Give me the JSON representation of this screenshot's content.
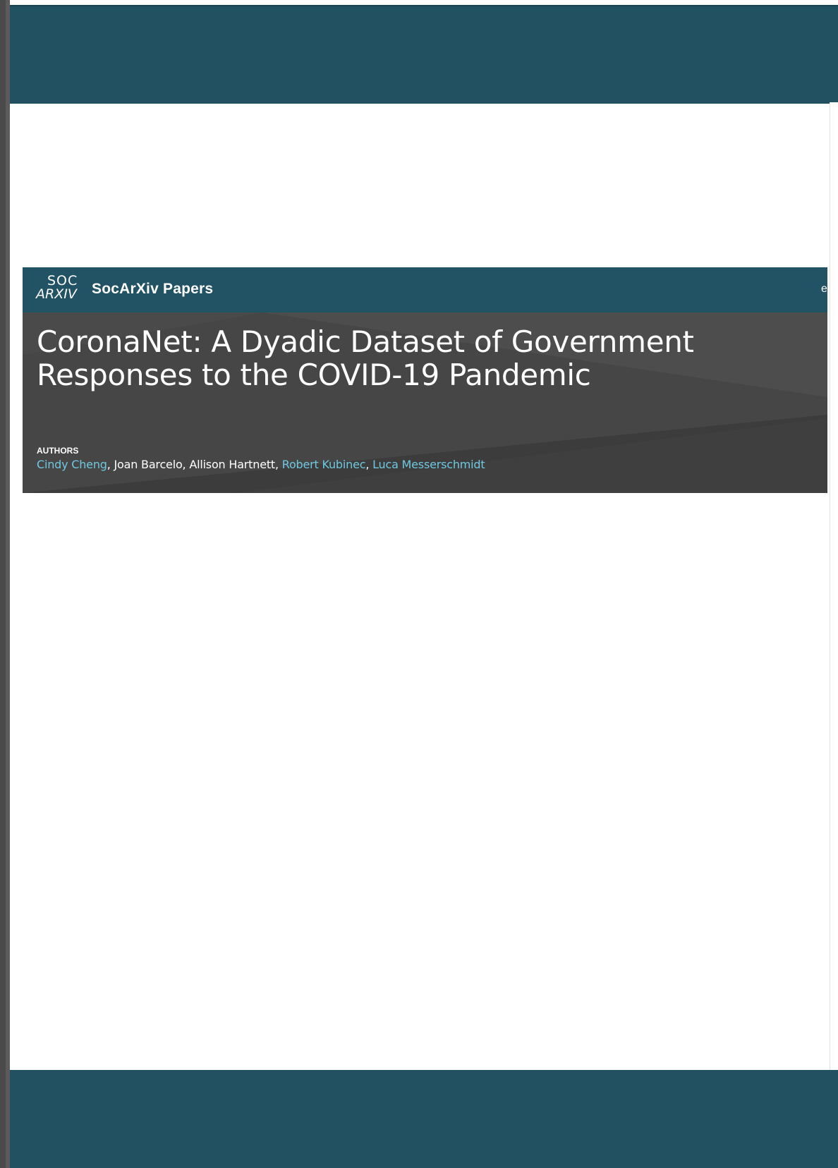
{
  "colors": {
    "frame_band": "#225262",
    "navbar": "#215365",
    "hero_background": "#464646",
    "link": "#6fc8e0",
    "text_light": "#ffffff"
  },
  "navbar": {
    "logo_top": "SOC",
    "logo_bottom": "ARXIV",
    "brand": "SocArXiv Papers",
    "edge_char": "e"
  },
  "preprint": {
    "title": "CoronaNet: A Dyadic Dataset of Government Responses to the COVID-19 Pandemic",
    "authors_label": "AUTHORS",
    "authors": [
      {
        "name": "Cindy Cheng",
        "linked": true,
        "sep": ", "
      },
      {
        "name": "Joan Barcelo",
        "linked": false,
        "sep": ", "
      },
      {
        "name": "Allison Hartnett",
        "linked": false,
        "sep": ", "
      },
      {
        "name": "Robert Kubinec",
        "linked": true,
        "sep": ", "
      },
      {
        "name": "Luca Messerschmidt",
        "linked": true,
        "sep": ""
      }
    ]
  }
}
